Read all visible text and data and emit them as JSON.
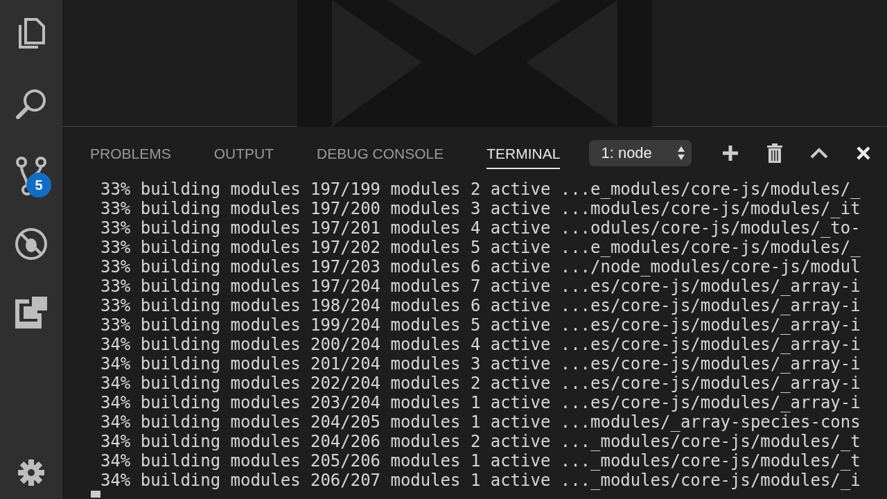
{
  "activity_bar": {
    "items": [
      {
        "kind": "files",
        "selected": false
      },
      {
        "kind": "search",
        "selected": false
      },
      {
        "kind": "git",
        "selected": false,
        "badge": "5"
      },
      {
        "kind": "debug",
        "selected": false
      },
      {
        "kind": "extensions",
        "selected": false
      }
    ],
    "bottom": [
      {
        "kind": "settings"
      }
    ]
  },
  "panel": {
    "tabs": [
      {
        "label": "PROBLEMS",
        "selected": false
      },
      {
        "label": "OUTPUT",
        "selected": false
      },
      {
        "label": "DEBUG CONSOLE",
        "selected": false
      },
      {
        "label": "TERMINAL",
        "selected": true
      }
    ],
    "terminal_select": {
      "value": "1: node"
    },
    "actions": [
      {
        "kind": "add"
      },
      {
        "kind": "trash"
      },
      {
        "kind": "maximize"
      },
      {
        "kind": "close"
      }
    ],
    "terminal": {
      "lines": [
        "33% building modules 197/199 modules 2 active ...e_modules/core-js/modules/_",
        "33% building modules 197/200 modules 3 active ...modules/core-js/modules/_it",
        "33% building modules 197/201 modules 4 active ...odules/core-js/modules/_to-",
        "33% building modules 197/202 modules 5 active ...e_modules/core-js/modules/_",
        "33% building modules 197/203 modules 6 active .../node_modules/core-js/modul",
        "33% building modules 197/204 modules 7 active ...es/core-js/modules/_array-i",
        "33% building modules 198/204 modules 6 active ...es/core-js/modules/_array-i",
        "33% building modules 199/204 modules 5 active ...es/core-js/modules/_array-i",
        "34% building modules 200/204 modules 4 active ...es/core-js/modules/_array-i",
        "34% building modules 201/204 modules 3 active ...es/core-js/modules/_array-i",
        "34% building modules 202/204 modules 2 active ...es/core-js/modules/_array-i",
        "34% building modules 203/204 modules 1 active ...es/core-js/modules/_array-i",
        "34% building modules 204/205 modules 1 active ...modules/_array-species-cons",
        "34% building modules 204/206 modules 2 active ..._modules/core-js/modules/_t",
        "34% building modules 205/206 modules 1 active ..._modules/core-js/modules/_t",
        "34% building modules 206/207 modules 1 active ..._modules/core-js/modules/_i"
      ]
    }
  }
}
